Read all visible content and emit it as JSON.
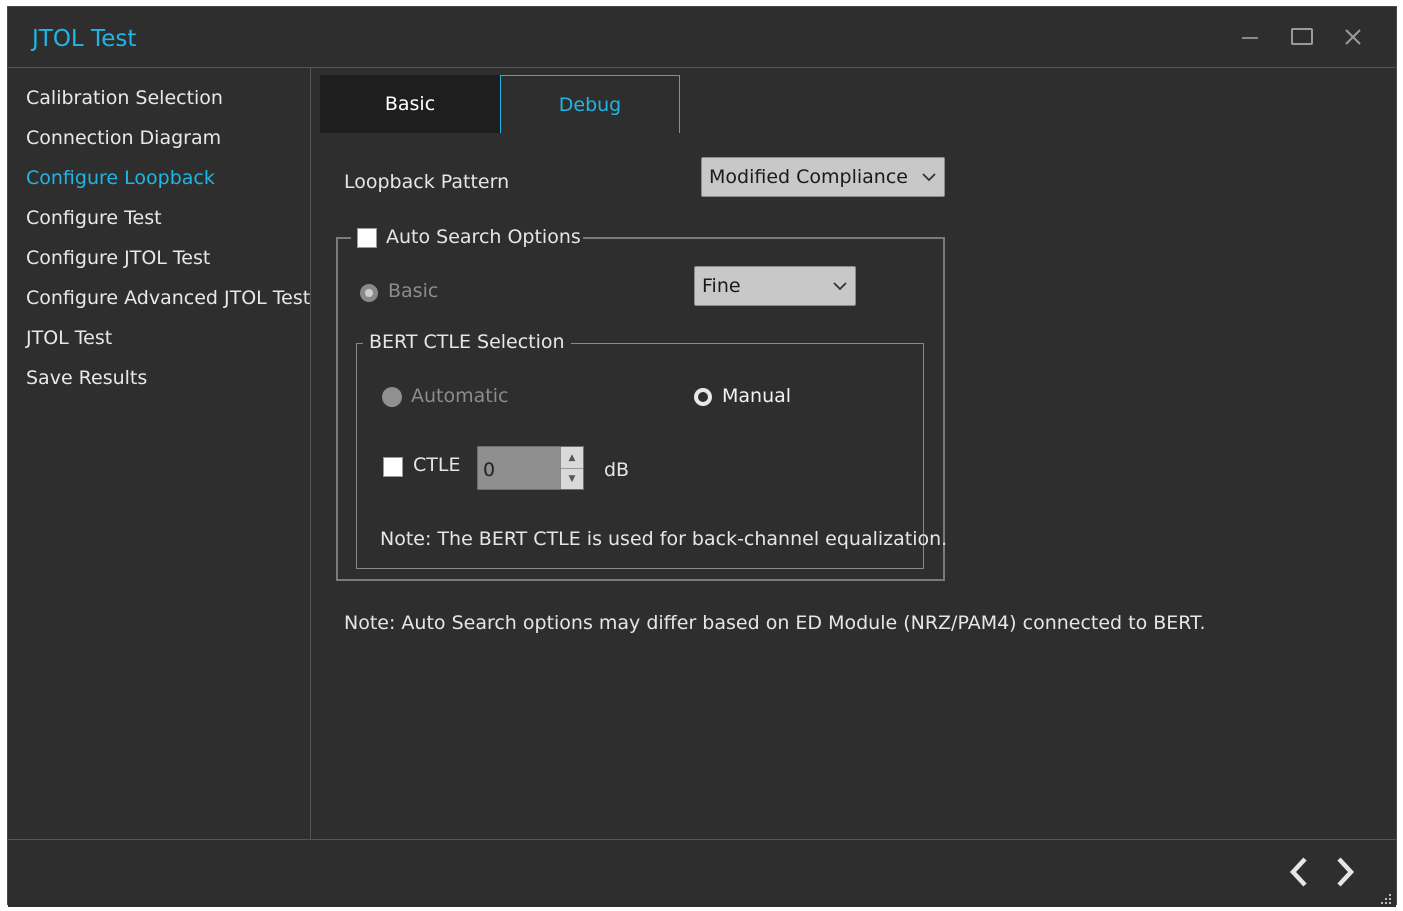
{
  "window": {
    "title": "JTOL Test"
  },
  "sidebar": {
    "items": [
      {
        "label": "Calibration Selection",
        "active": false
      },
      {
        "label": "Connection Diagram",
        "active": false
      },
      {
        "label": "Configure Loopback",
        "active": true
      },
      {
        "label": "Configure Test",
        "active": false
      },
      {
        "label": "Configure JTOL Test",
        "active": false
      },
      {
        "label": "Configure Advanced JTOL Test",
        "active": false
      },
      {
        "label": "JTOL Test",
        "active": false
      },
      {
        "label": "Save Results",
        "active": false
      }
    ]
  },
  "tabs": [
    {
      "label": "Basic",
      "selected": false
    },
    {
      "label": "Debug",
      "selected": true
    }
  ],
  "loopback": {
    "label": "Loopback Pattern",
    "value": "Modified Compliance"
  },
  "auto_search": {
    "label": "Auto Search Options",
    "checked": false,
    "basic_label": "Basic",
    "precision_value": "Fine"
  },
  "bert_ctle": {
    "title": "BERT CTLE Selection",
    "automatic_label": "Automatic",
    "manual_label": "Manual",
    "selected": "Manual",
    "ctle_label": "CTLE",
    "ctle_checked": false,
    "ctle_value": "0",
    "unit": "dB",
    "note": "Note: The BERT CTLE is used for back-channel equalization."
  },
  "footer_note": "Note: Auto Search options may differ based on ED Module (NRZ/PAM4) connected to BERT.",
  "colors": {
    "accent": "#1eb6e6",
    "background": "#2e2e2e",
    "tab_inactive": "#1e1e1e"
  }
}
